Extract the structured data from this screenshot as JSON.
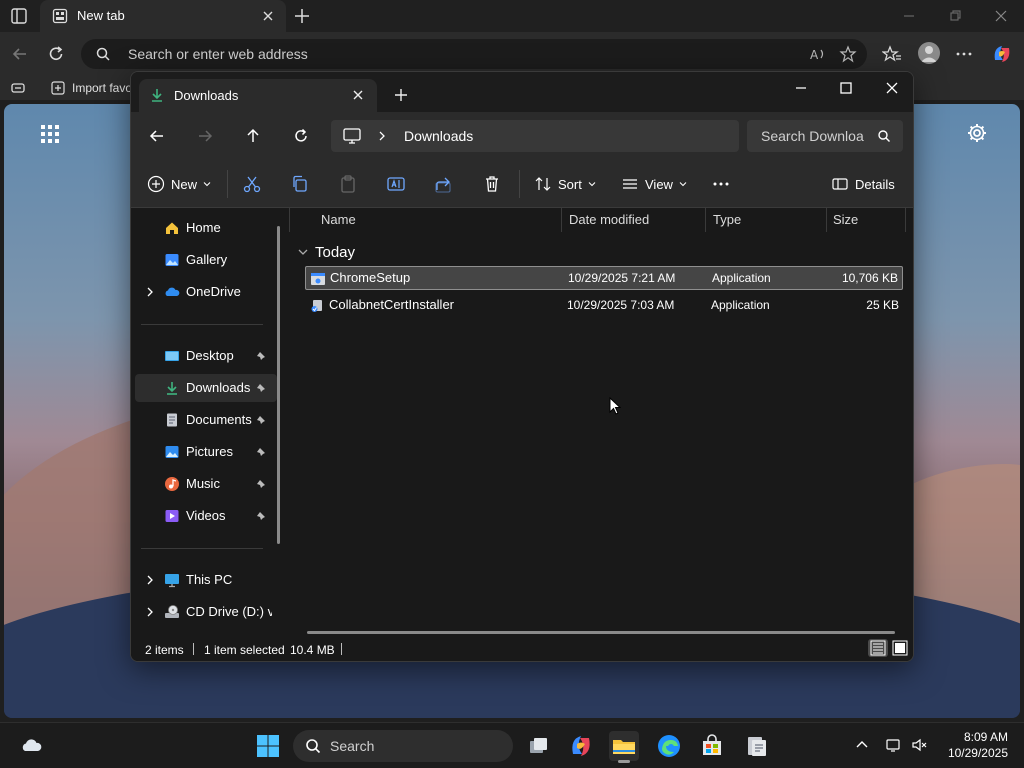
{
  "browser": {
    "tab_title": "New tab",
    "address_placeholder": "Search or enter web address",
    "favorites_item": "Import favo"
  },
  "explorer": {
    "tab_title": "Downloads",
    "breadcrumb": "Downloads",
    "search_placeholder": "Search Downloa",
    "commands": {
      "new": "New",
      "sort": "Sort",
      "view": "View",
      "details": "Details"
    },
    "sidebar": {
      "top": [
        {
          "label": "Home",
          "icon": "home-icon"
        },
        {
          "label": "Gallery",
          "icon": "gallery-icon"
        },
        {
          "label": "OneDrive",
          "icon": "onedrive-icon"
        }
      ],
      "pinned": [
        {
          "label": "Desktop",
          "icon": "desktop-icon"
        },
        {
          "label": "Downloads",
          "icon": "download-icon"
        },
        {
          "label": "Documents",
          "icon": "documents-icon"
        },
        {
          "label": "Pictures",
          "icon": "pictures-icon"
        },
        {
          "label": "Music",
          "icon": "music-icon"
        },
        {
          "label": "Videos",
          "icon": "videos-icon"
        }
      ],
      "drives": [
        {
          "label": "This PC",
          "icon": "this-pc-icon"
        },
        {
          "label": "CD Drive (D:) vir",
          "icon": "cd-drive-icon"
        }
      ]
    },
    "columns": [
      "Name",
      "Date modified",
      "Type",
      "Size"
    ],
    "group": "Today",
    "files": [
      {
        "name": "ChromeSetup",
        "date": "10/29/2025 7:21 AM",
        "type": "Application",
        "size": "10,706 KB"
      },
      {
        "name": "CollabnetCertInstaller",
        "date": "10/29/2025 7:03 AM",
        "type": "Application",
        "size": "25 KB"
      }
    ],
    "status": {
      "items": "2 items",
      "selected": "1 item selected",
      "size": "10.4 MB"
    }
  },
  "taskbar": {
    "search_placeholder": "Search",
    "time": "8:09 AM",
    "date": "10/29/2025"
  },
  "colors": {
    "accent_green": "#3fb37f",
    "folder_yellow": "#f4c23b",
    "edge_blue": "#1e90ff"
  }
}
